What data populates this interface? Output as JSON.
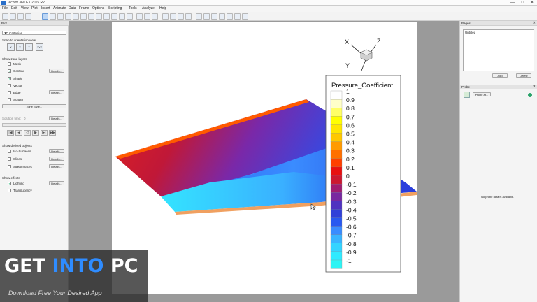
{
  "window": {
    "title": "Tecplot 360 EX 2015 R2",
    "controls": [
      "—",
      "□",
      "✕"
    ]
  },
  "menu": [
    "File",
    "Edit",
    "View",
    "Plot",
    "Insert",
    "Animate",
    "Data",
    "Frame",
    "Options",
    "Scripting",
    "Tools",
    "Analyze",
    "Help"
  ],
  "left_panel": {
    "header": "Plot",
    "plot_type": "3D Cartesian",
    "snap_label": "Snap to orientation view",
    "orient_buttons": [
      "X",
      "Y",
      "Z",
      "XYZ"
    ],
    "zone_layers_label": "Show zone layers",
    "layers": [
      {
        "label": "Mesh",
        "checked": false,
        "button": ""
      },
      {
        "label": "Contour",
        "checked": true,
        "button": "Details..."
      },
      {
        "label": "Shade",
        "checked": true,
        "button": ""
      },
      {
        "label": "Vector",
        "checked": false,
        "button": ""
      },
      {
        "label": "Edge",
        "checked": false,
        "button": "Details..."
      },
      {
        "label": "Scatter",
        "checked": false,
        "button": ""
      }
    ],
    "zone_style_button": "Zone Style...",
    "solution_time_label": "Solution time:",
    "solution_time_value": "0",
    "details_button": "Details...",
    "derived_label": "Show derived objects",
    "derived": [
      {
        "label": "Iso-Surfaces",
        "checked": false,
        "button": "Details..."
      },
      {
        "label": "Slices",
        "checked": false,
        "button": "Details..."
      },
      {
        "label": "Streamtraces",
        "checked": false,
        "button": "Details..."
      }
    ],
    "effects_label": "Show effects",
    "effects": [
      {
        "label": "Lighting",
        "checked": true,
        "button": "Details..."
      },
      {
        "label": "Translucency",
        "checked": false,
        "button": ""
      }
    ]
  },
  "canvas": {
    "axes": {
      "x": "X",
      "y": "Y",
      "z": "Z"
    },
    "legend": {
      "title": "Pressure_Coefficient",
      "levels": [
        "1",
        "0.9",
        "0.8",
        "0.7",
        "0.6",
        "0.5",
        "0.4",
        "0.3",
        "0.2",
        "0.1",
        "0",
        "-0.1",
        "-0.2",
        "-0.3",
        "-0.4",
        "-0.5",
        "-0.6",
        "-0.7",
        "-0.8",
        "-0.9",
        "-1"
      ],
      "colors": [
        "#ffffff",
        "#ffffc8",
        "#ffff66",
        "#ffff00",
        "#ffe600",
        "#ffc800",
        "#ff9a00",
        "#ff7000",
        "#ff4000",
        "#e81010",
        "#cc1830",
        "#a01c70",
        "#7828a0",
        "#5032c0",
        "#3040d8",
        "#2858f0",
        "#3a8cff",
        "#3ab4ff",
        "#34d4ff",
        "#30eaff",
        "#2ef4f4"
      ]
    }
  },
  "right_panel": {
    "pages_header": "Pages",
    "page_item": "Untitled",
    "add_button": "Add",
    "delete_button": "Delete",
    "probe_header": "Probe",
    "probe_button": "Probe at...",
    "probe_message": "No probe data is available."
  },
  "watermark": {
    "part1": "GET ",
    "part2": "INTO",
    "part3": " PC",
    "subtitle": "Download Free Your Desired App"
  }
}
